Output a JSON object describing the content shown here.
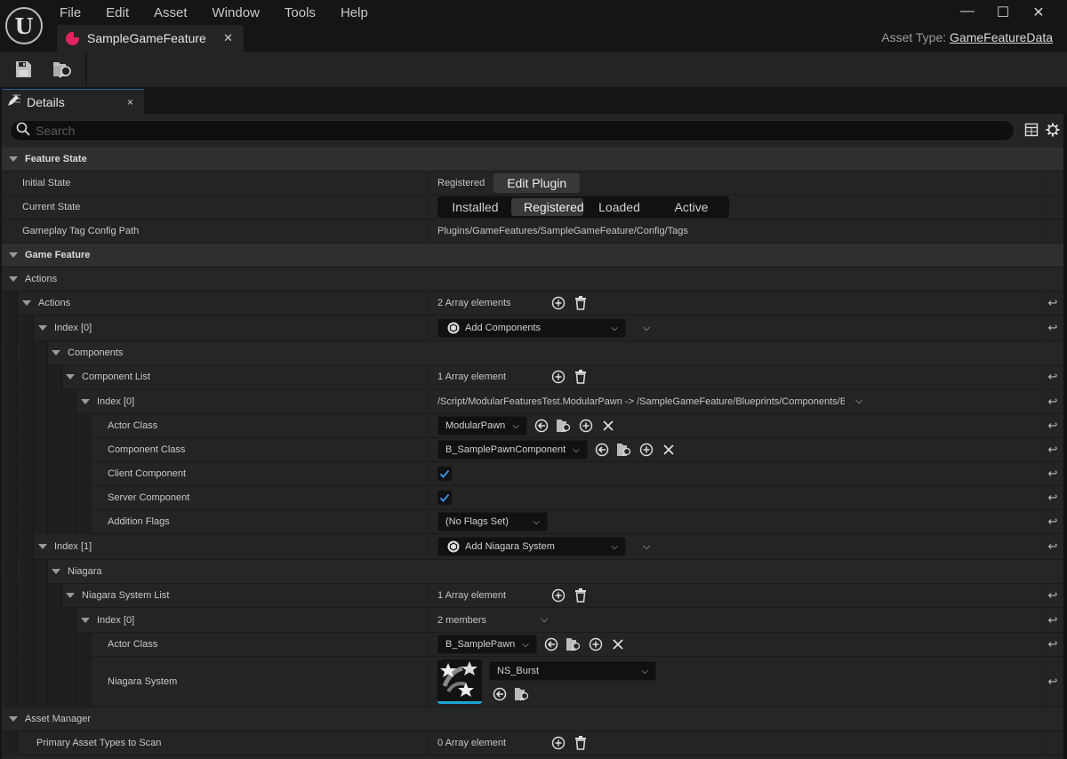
{
  "app": {
    "logo": "U",
    "menu": [
      "File",
      "Edit",
      "Asset",
      "Window",
      "Tools",
      "Help"
    ],
    "document_tab": "SampleGameFeature",
    "asset_type_label": "Asset Type:",
    "asset_type_value": "GameFeatureData",
    "window_controls": {
      "minimize": "—",
      "maximize": "☐",
      "close": "✕"
    }
  },
  "toolbar": {
    "save": "save-icon",
    "browse": "browse-to-asset-icon"
  },
  "details_tab": {
    "label": "Details",
    "close": "×"
  },
  "search": {
    "placeholder": "Search",
    "value": ""
  },
  "feature_state": {
    "label": "Feature State",
    "initial_state_label": "Initial State",
    "initial_state_value": "Registered",
    "edit_plugin": "Edit Plugin",
    "current_state_label": "Current State",
    "states": [
      "Installed",
      "Registered",
      "Loaded",
      "Active"
    ],
    "current_state": "Registered",
    "tag_path_label": "Gameplay Tag Config Path",
    "tag_path_value": "Plugins/GameFeatures/SampleGameFeature/Config/Tags"
  },
  "game_feature": {
    "label": "Game Feature",
    "actions_cat": "Actions",
    "actions_label": "Actions",
    "actions_count": "2 Array elements",
    "index0": {
      "label": "Index",
      "num": "0",
      "type": "Add Components",
      "components_label": "Components",
      "component_list_label": "Component List",
      "component_list_count": "1 Array element",
      "entry": {
        "label": "Index",
        "num": "0",
        "summary": "/Script/ModularFeaturesTest.ModularPawn -> /SampleGameFeature/Blueprints/Components/B_S",
        "actor_class_label": "Actor Class",
        "actor_class_value": "ModularPawn",
        "component_class_label": "Component Class",
        "component_class_value": "B_SamplePawnComponent",
        "client_label": "Client Component",
        "client_checked": true,
        "server_label": "Server Component",
        "server_checked": true,
        "flags_label": "Addition Flags",
        "flags_value": "(No Flags Set)"
      }
    },
    "index1": {
      "label": "Index",
      "num": "1",
      "type": "Add Niagara System",
      "niagara_label": "Niagara",
      "system_list_label": "Niagara System List",
      "system_list_count": "1 Array element",
      "entry": {
        "label": "Index",
        "num": "0",
        "summary": "2 members",
        "actor_class_label": "Actor Class",
        "actor_class_value": "B_SamplePawn",
        "system_label": "Niagara System",
        "system_value": "NS_Burst"
      }
    }
  },
  "asset_manager": {
    "label": "Asset Manager",
    "primary_label": "Primary Asset Types to Scan",
    "primary_count": "0 Array element"
  },
  "colors": {
    "accent_blue": "#1aa3d6",
    "asset_icon": "#e0245e",
    "check": "#3a8ee6"
  }
}
